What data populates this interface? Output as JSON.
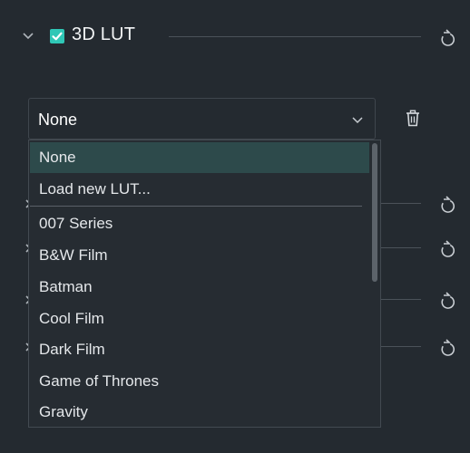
{
  "section": {
    "title": "3D LUT",
    "enabled": true,
    "expanded": true
  },
  "lut_select": {
    "value": "None",
    "open": true
  },
  "dropdown": {
    "options": [
      "None",
      "Load new LUT...",
      "007 Series",
      "B&W Film",
      "Batman",
      "Cool Film",
      "Dark Film",
      "Game of Thrones",
      "Gravity"
    ],
    "selected_index": 0
  },
  "icons": {
    "expand": "chevron-down-icon",
    "checkbox": "checkmark-icon",
    "reset": "reset-icon",
    "delete": "trash-icon",
    "collapsed_row": "chevron-right-icon"
  },
  "colors": {
    "background": "#242a30",
    "accent": "#2fc7b6",
    "selected_option": "#2d4a4b",
    "text": "#e4e7ea"
  }
}
